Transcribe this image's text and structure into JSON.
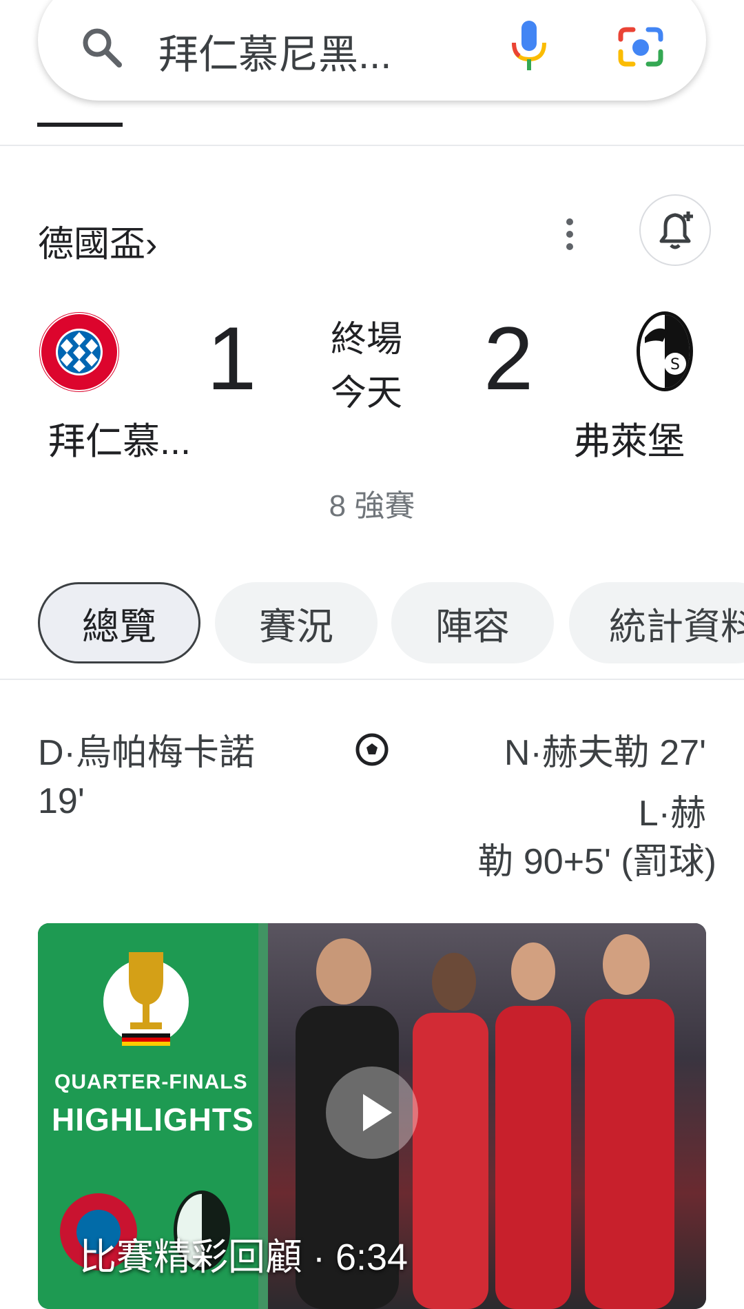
{
  "search": {
    "query": "拜仁慕尼黑..."
  },
  "league": {
    "name": "德國盃",
    "chevron": "›"
  },
  "match": {
    "home_team": "拜仁慕...",
    "home_score": "1",
    "status": "終場",
    "status_sub": "今天",
    "away_score": "2",
    "away_team": "弗萊堡",
    "round": "8 強賽"
  },
  "tabs": [
    {
      "label": "總覽",
      "active": true
    },
    {
      "label": "賽況",
      "active": false
    },
    {
      "label": "陣容",
      "active": false
    },
    {
      "label": "統計資料",
      "active": false
    }
  ],
  "goals": {
    "home": [
      "D·烏帕梅卡諾 19'"
    ],
    "away_lines": [
      "N·赫夫勒 27'",
      "L·赫",
      "勒 90+5' (罰球)"
    ]
  },
  "video": {
    "overlay_line1": "QUARTER-FINALS",
    "overlay_line2": "HIGHLIGHTS",
    "caption": "比賽精彩回顧 · 6:34"
  },
  "colors": {
    "accent_red": "#dc052d",
    "bayern_blue": "#0066b2",
    "video_green": "#1e9a52",
    "google_blue": "#4285f4",
    "google_red": "#ea4335",
    "google_yellow": "#fbbc04",
    "google_green": "#34a853"
  },
  "icons": [
    "search-icon",
    "mic-icon",
    "lens-icon",
    "more-vert-icon",
    "bell-add-icon",
    "soccer-ball-icon",
    "play-icon"
  ]
}
